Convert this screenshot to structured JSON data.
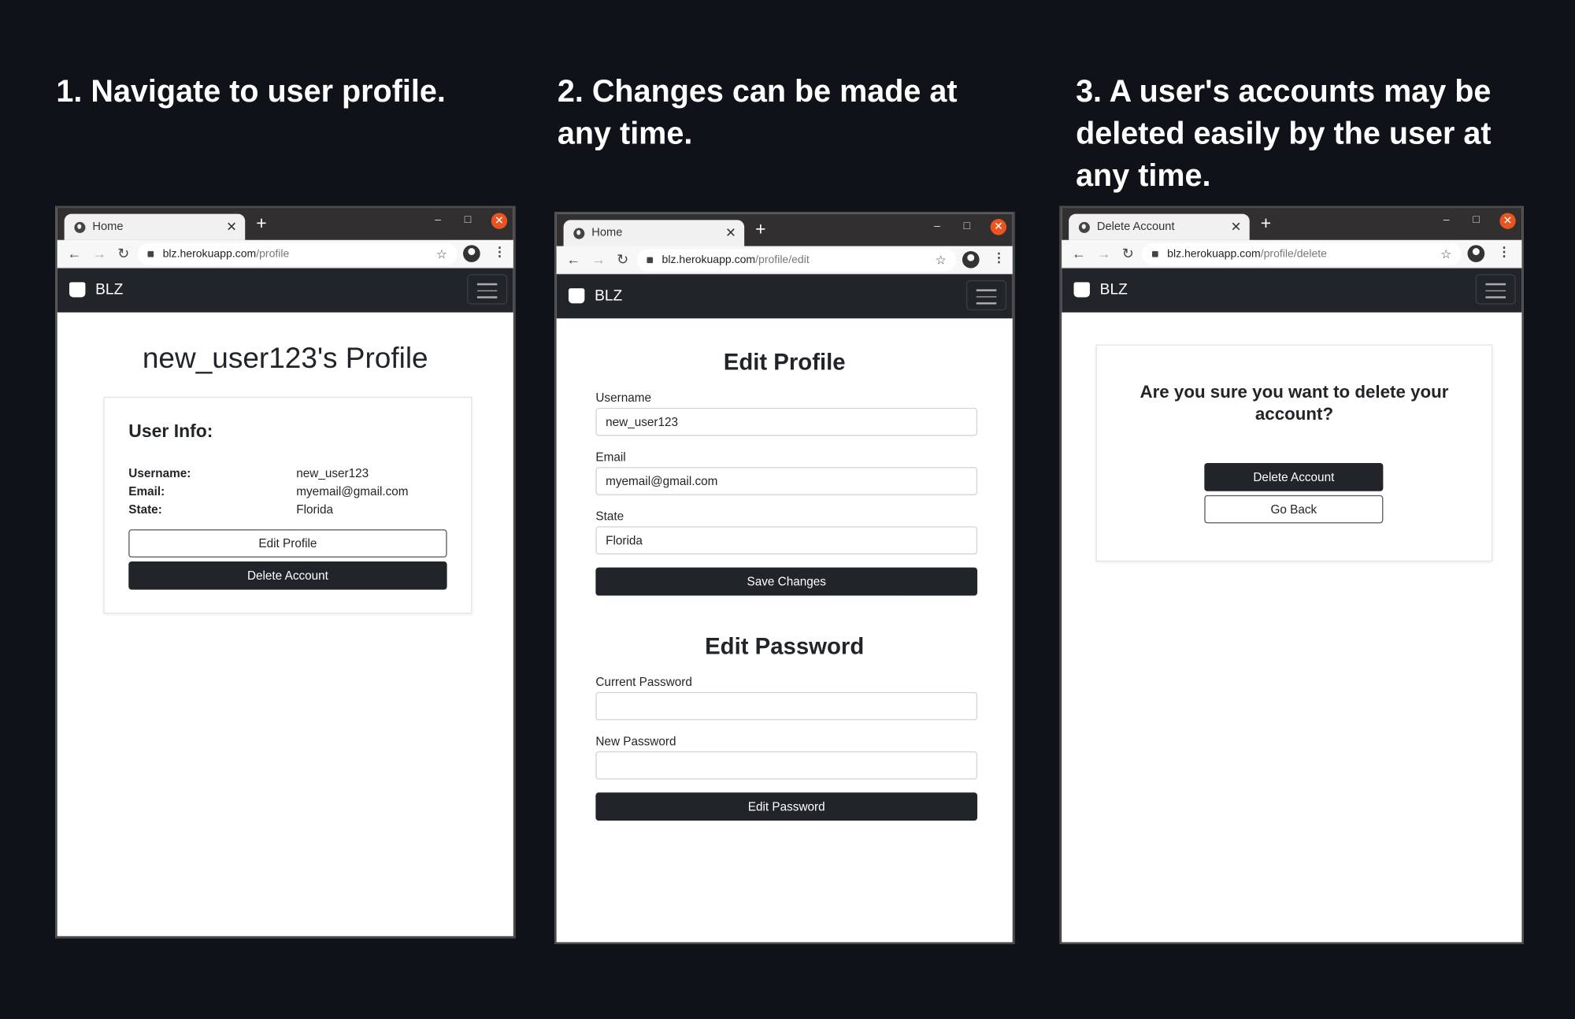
{
  "steps": [
    "1. Navigate to user profile.",
    "2. Changes can be made at any time.",
    "3. A user's accounts may be deleted easily by the user at any time."
  ],
  "colors": {
    "background": "#0f1218",
    "navbar": "#212529",
    "close": "#e95420"
  },
  "browsers": [
    {
      "tab_title": "Home",
      "url_host": "blz.herokuapp.com",
      "url_path": "/profile",
      "brand": "BLZ"
    },
    {
      "tab_title": "Home",
      "url_host": "blz.herokuapp.com",
      "url_path": "/profile/edit",
      "brand": "BLZ"
    },
    {
      "tab_title": "Delete Account",
      "url_host": "blz.herokuapp.com",
      "url_path": "/profile/delete",
      "brand": "BLZ"
    }
  ],
  "profile": {
    "title": "new_user123's Profile",
    "section": "User Info:",
    "rows": [
      {
        "label": "Username:",
        "value": "new_user123"
      },
      {
        "label": "Email:",
        "value": "myemail@gmail.com"
      },
      {
        "label": "State:",
        "value": "Florida"
      }
    ],
    "edit_button": "Edit Profile",
    "delete_button": "Delete Account"
  },
  "edit": {
    "profile_title": "Edit Profile",
    "username_label": "Username",
    "username_value": "new_user123",
    "email_label": "Email",
    "email_value": "myemail@gmail.com",
    "state_label": "State",
    "state_value": "Florida",
    "save_button": "Save Changes",
    "password_title": "Edit Password",
    "current_label": "Current Password",
    "current_value": "",
    "new_label": "New Password",
    "new_value": "",
    "password_button": "Edit Password"
  },
  "delete": {
    "question": "Are you sure you want to delete your account?",
    "delete_button": "Delete Account",
    "back_button": "Go Back"
  }
}
